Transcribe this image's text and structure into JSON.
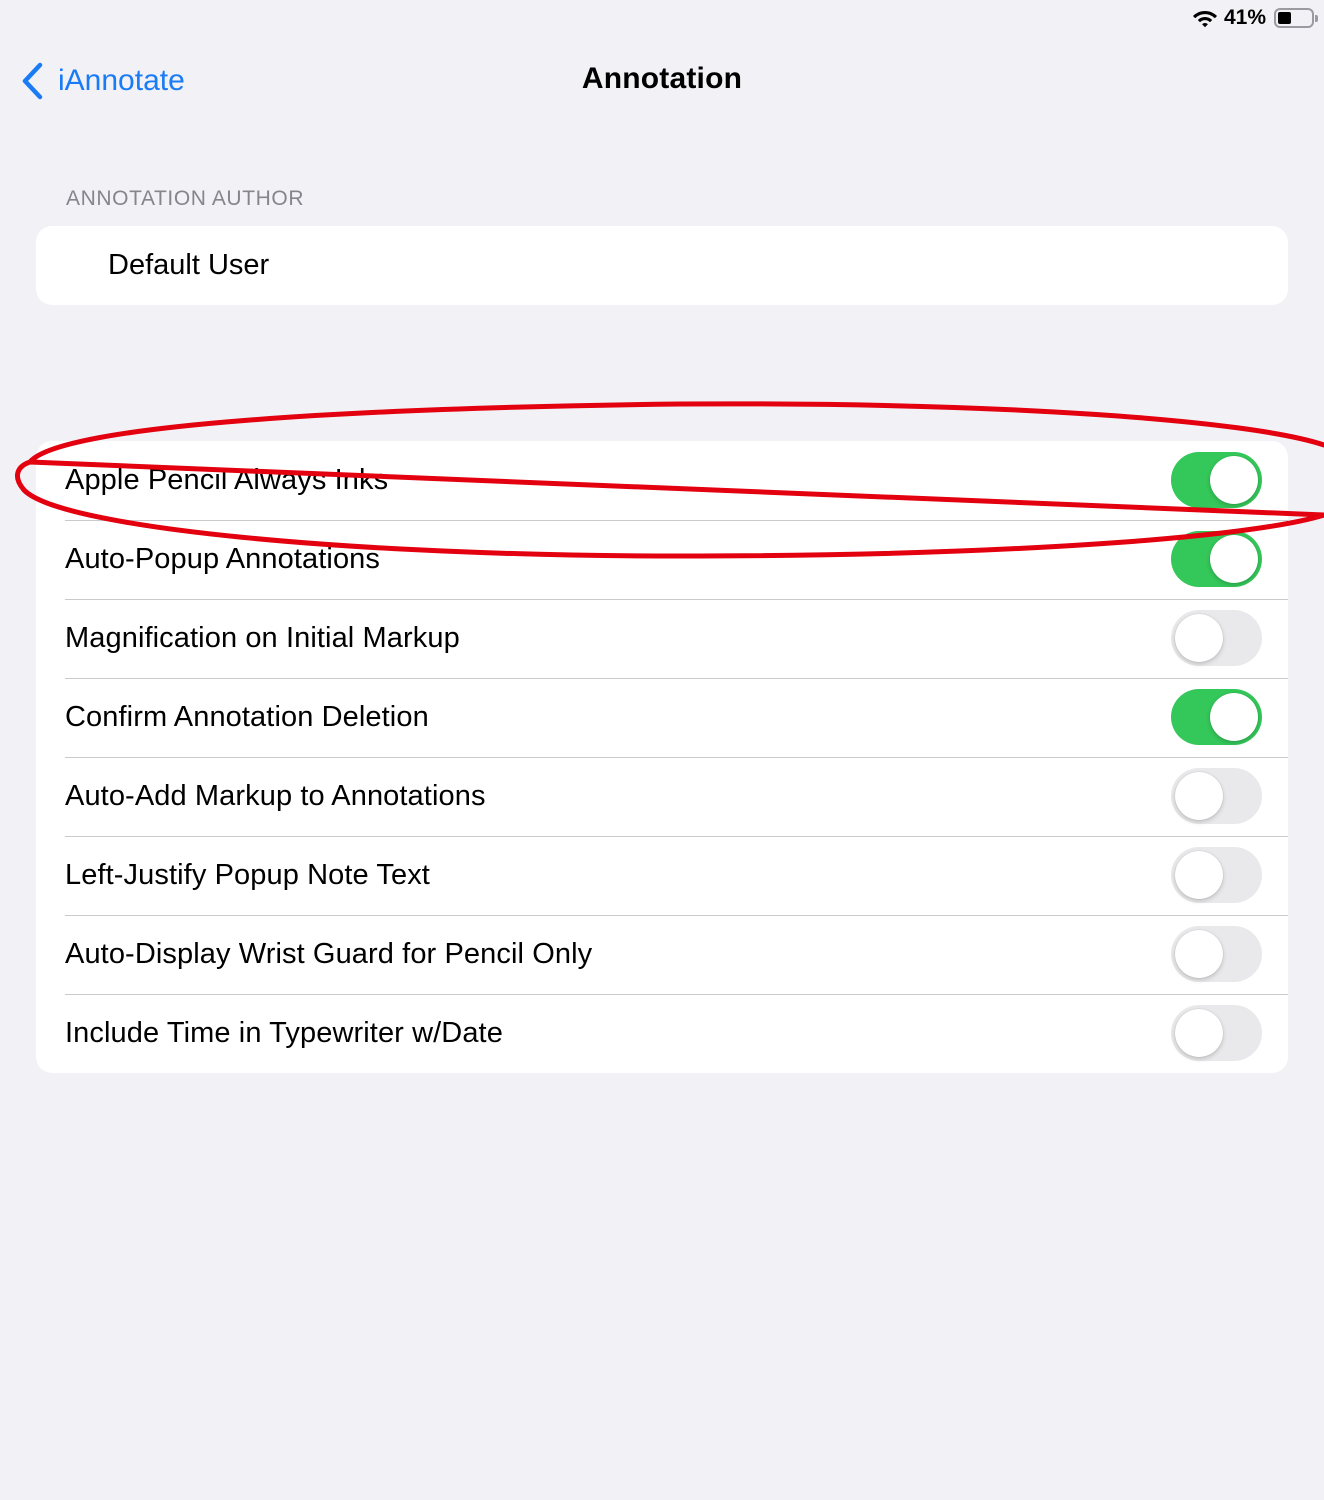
{
  "status_bar": {
    "battery_percent": "41%",
    "battery_level": 0.41,
    "wifi_icon": "wifi-icon",
    "battery_icon": "battery-icon"
  },
  "nav": {
    "back_label": "iAnnotate",
    "back_icon": "chevron-left-icon",
    "title": "Annotation",
    "accent_color": "#1a7cf5"
  },
  "author_section": {
    "header": "ANNOTATION AUTHOR",
    "value": "Default User"
  },
  "settings": [
    {
      "label": "Apple Pencil Always Inks",
      "on": true
    },
    {
      "label": "Auto-Popup Annotations",
      "on": true
    },
    {
      "label": "Magnification on Initial Markup",
      "on": false
    },
    {
      "label": "Confirm Annotation Deletion",
      "on": true
    },
    {
      "label": "Auto-Add Markup to Annotations",
      "on": false
    },
    {
      "label": "Left-Justify Popup Note Text",
      "on": false
    },
    {
      "label": "Auto-Display Wrist Guard for Pencil Only",
      "on": false
    },
    {
      "label": "Include Time in Typewriter w/Date",
      "on": false
    }
  ],
  "colors": {
    "toggle_on": "#34c759",
    "toggle_off": "#e9e9eb",
    "background": "#f1f1f6",
    "highlight": "#e3000f"
  }
}
